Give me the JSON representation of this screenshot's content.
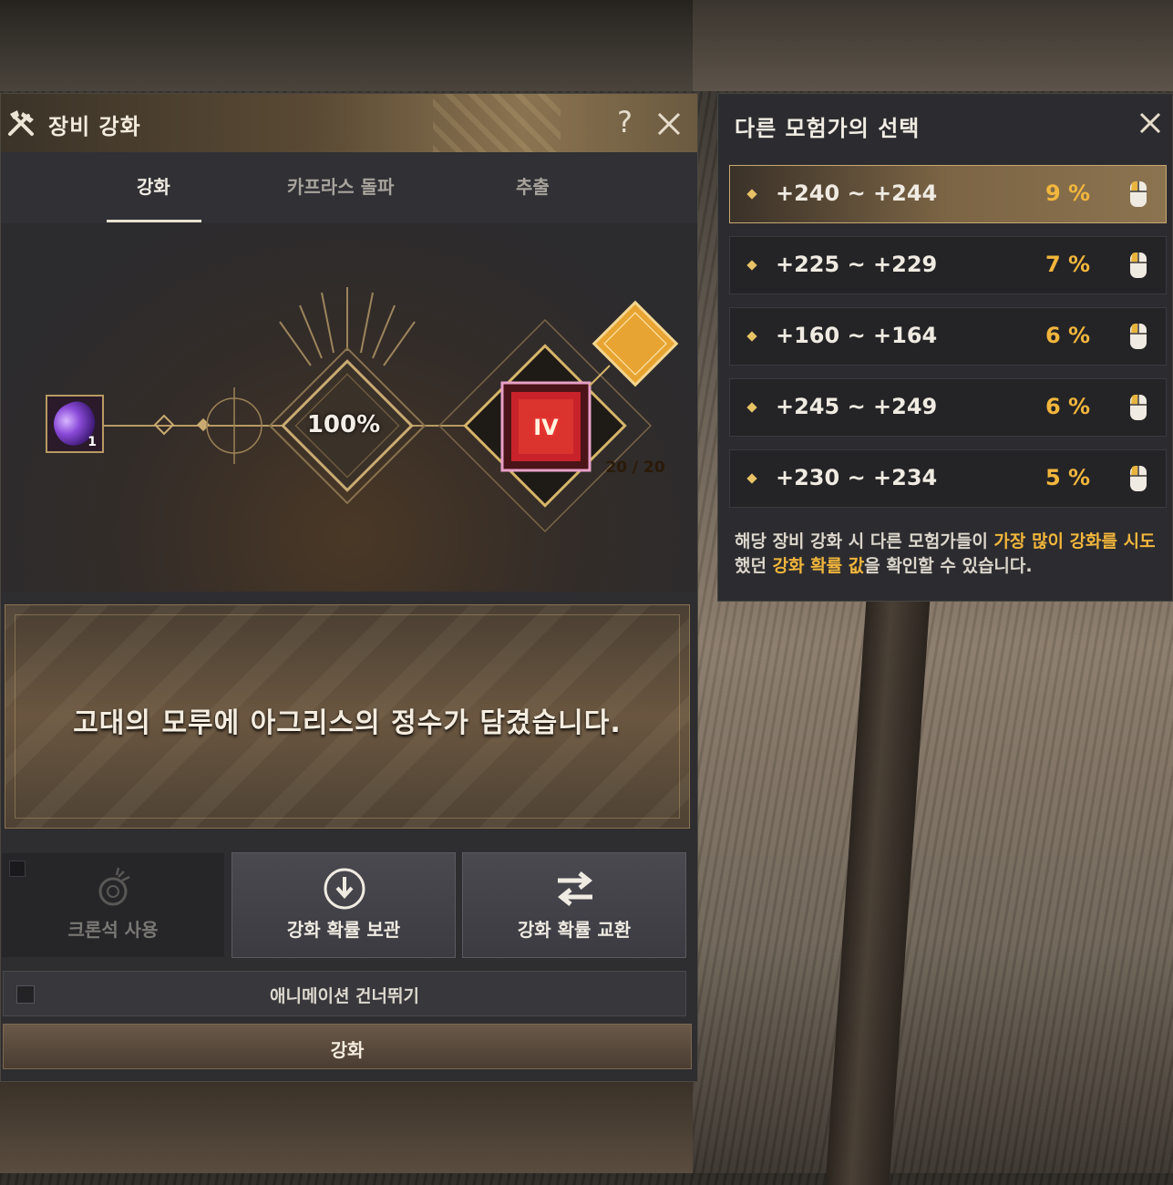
{
  "window": {
    "title": "장비 강화",
    "help_label": "?",
    "tabs": [
      {
        "label": "강화",
        "active": true
      },
      {
        "label": "카프라스 돌파",
        "active": false
      },
      {
        "label": "추출",
        "active": false
      }
    ]
  },
  "stage": {
    "material_count": "1",
    "success_rate": "100%",
    "counter": "20 / 20",
    "tier": "IV"
  },
  "message": "고대의 모루에 아그리스의 정수가 담겼습니다.",
  "buttons": [
    {
      "label": "크론석 사용",
      "enabled": false,
      "icon": "chronos-stone-icon"
    },
    {
      "label": "강화 확률 보관",
      "enabled": true,
      "icon": "store-arrow-icon"
    },
    {
      "label": "강화 확률 교환",
      "enabled": true,
      "icon": "swap-arrows-icon"
    }
  ],
  "skip_animation_label": "애니메이션 건너뛰기",
  "enhance_label": "강화",
  "others_panel": {
    "title": "다른 모험가의 선택",
    "choices": [
      {
        "range": "+240 ~ +244",
        "percent": "9 %",
        "selected": true
      },
      {
        "range": "+225 ~ +229",
        "percent": "7 %",
        "selected": false
      },
      {
        "range": "+160 ~ +164",
        "percent": "6 %",
        "selected": false
      },
      {
        "range": "+245 ~ +249",
        "percent": "6 %",
        "selected": false
      },
      {
        "range": "+230 ~ +234",
        "percent": "5 %",
        "selected": false
      }
    ],
    "description": {
      "part1": "해당 장비 강화 시 다른 모험가들이 ",
      "hl1": "가장 많이 강화를 시도",
      "part2": "했던 ",
      "hl2": "강화 확률 값",
      "part3": "을 확인할 수 있습니다."
    }
  },
  "colors": {
    "accent_gold": "#f2b63c",
    "panel_bg": "#2e2d30",
    "tier_red": "#c8232a"
  }
}
